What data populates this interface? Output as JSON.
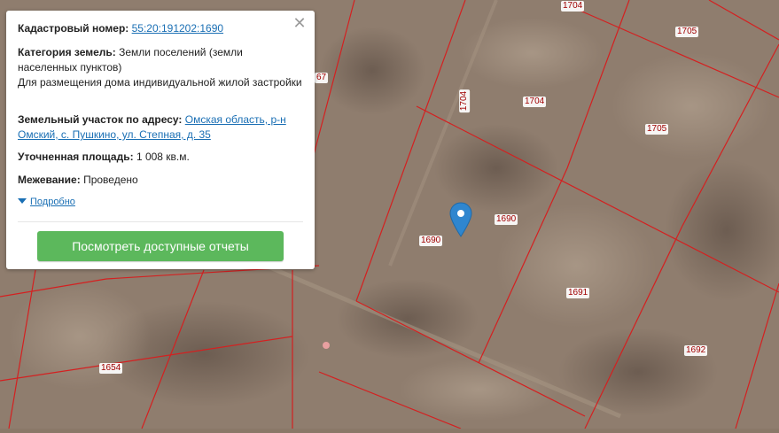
{
  "map": {
    "parcel_labels": [
      "1704",
      "1705",
      "1704",
      "1704",
      "1705",
      "1690",
      "1690",
      "1691",
      "1692",
      "1654",
      "67"
    ],
    "parcel_line_color": "#d42020",
    "marker_color": "#2f86cf"
  },
  "popup": {
    "close_glyph": "✕",
    "cadastral_label": "Кадастровый номер:",
    "cadastral_value": "55:20:191202:1690",
    "category_label": "Категория земель:",
    "category_value": "Земли поселений (земли населенных пунктов)",
    "usage_value": "Для размещения дома индивидуальной жилой застройки",
    "address_label": "Земельный участок по адресу:",
    "address_value": "Омская область, р-н Омский, с. Пушкино, ул. Степная, д. 35",
    "area_label": "Уточненная площадь:",
    "area_value": "1 008 кв.м.",
    "survey_label": "Межевание:",
    "survey_value": "Проведено",
    "more_label": "Подробно",
    "reports_button": "Посмотреть доступные отчеты",
    "button_color": "#5cb85c"
  }
}
